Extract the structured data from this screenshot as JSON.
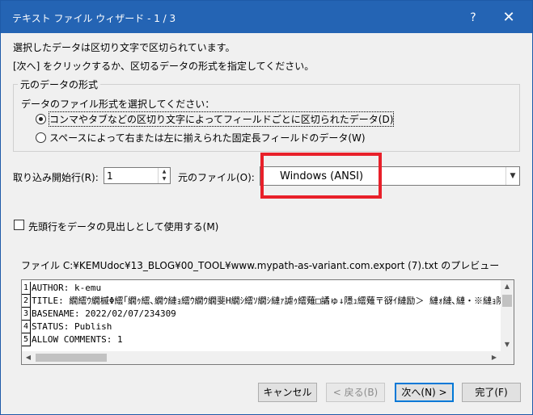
{
  "window": {
    "title": "テキスト ファイル ウィザード - 1 / 3",
    "help": "?",
    "close": "✕"
  },
  "intro": {
    "line1": "選択したデータは区切り文字で区切られています。",
    "line2": "[次へ] をクリックするか、区切るデータの形式を指定してください。"
  },
  "format_group": {
    "title": "元のデータの形式",
    "instruction": "データのファイル形式を選択してください：",
    "options": [
      {
        "label": "コンマやタブなどの区切り文字によってフィールドごとに区切られたデータ(D)",
        "selected": true
      },
      {
        "label": "スペースによって右または左に揃えられた固定長フィールドのデータ(W)",
        "selected": false
      }
    ]
  },
  "import": {
    "start_row_label": "取り込み開始行(R):",
    "start_row_value": "1",
    "origin_label": "元のファイル(O):",
    "origin_value": "Windows (ANSI)"
  },
  "header_checkbox": {
    "label": "先頭行をデータの見出しとして使用する(M)",
    "checked": false
  },
  "preview": {
    "label": "ファイル C:¥KEMUdoc¥13_BLOG¥00_TOOL¥www.mypath-as-variant.com.export (7).txt のプレビュー",
    "rows": [
      {
        "num": "1",
        "text": "AUTHOR: k-emu"
      },
      {
        "num": "2",
        "text": "TITLE: 繝繧ｳ繝槭Φ繧｢繝ｩ繧､繝ｳ縺ｮ繧ｳ繝ｳ繝斐Η繝ｼ繧ｿ繝ｼ縺ｧ謔ｩ繧薙□譎ゅ↓隱ｭ繧薙〒谺ｲ縺励＞ 縺ｫ縺､縺・※縺ｮ險倅ｺ"
      },
      {
        "num": "3",
        "text": "BASENAME: 2022/02/07/234309"
      },
      {
        "num": "4",
        "text": "STATUS: Publish"
      },
      {
        "num": "5",
        "text": "ALLOW COMMENTS: 1"
      }
    ]
  },
  "buttons": {
    "cancel": "キャンセル",
    "back": "< 戻る(B)",
    "next": "次へ(N) >",
    "finish": "完了(F)"
  },
  "colors": {
    "titlebar": "#2464b4",
    "highlight": "#e8202a",
    "focus_border": "#0078d7"
  }
}
